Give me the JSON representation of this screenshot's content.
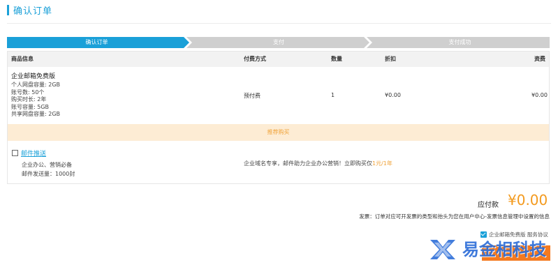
{
  "page": {
    "title": "确认订单"
  },
  "steps": [
    {
      "label": "确认订单",
      "active": true
    },
    {
      "label": "支付",
      "active": false
    },
    {
      "label": "支付成功",
      "active": false
    }
  ],
  "table": {
    "headers": [
      "商品信息",
      "付费方式",
      "数量",
      "折扣",
      "资费"
    ],
    "product": {
      "name": "企业邮箱免费版",
      "specs": [
        "个人网盘容量: 2GB",
        "账号数: 50个",
        "购买时长: 2年",
        "账号容量: 5GB",
        "共享网盘容量: 2GB"
      ]
    },
    "pay_type": "预付费",
    "quantity": "1",
    "discount": "¥0.00",
    "fee": "¥0.00"
  },
  "recommend": {
    "label": "推荐购买"
  },
  "addon": {
    "name": "邮件推送",
    "desc1": "企业办公、营销必备",
    "desc2": "邮件发送量：1000封",
    "promo_text": "企业域名专享，邮件助力企业办公营销！立即购买仅",
    "promo_price": "1元/1年"
  },
  "payment": {
    "label": "应付款",
    "amount": "¥0.00"
  },
  "invoice": {
    "text": "发票：订单对应可开发票的类型和抬头为您在用户中心-发票信息管理中设置的信息"
  },
  "agreement": {
    "text": "企业邮箱免费版 服务协议"
  },
  "watermark": {
    "text": "易金相科技",
    "icon": "logo-x-icon"
  },
  "colors": {
    "primary": "#1aa0d8",
    "accent": "#f39a1e",
    "step_inactive": "#cfcfcf",
    "recommend_bg": "#fdecd4"
  }
}
